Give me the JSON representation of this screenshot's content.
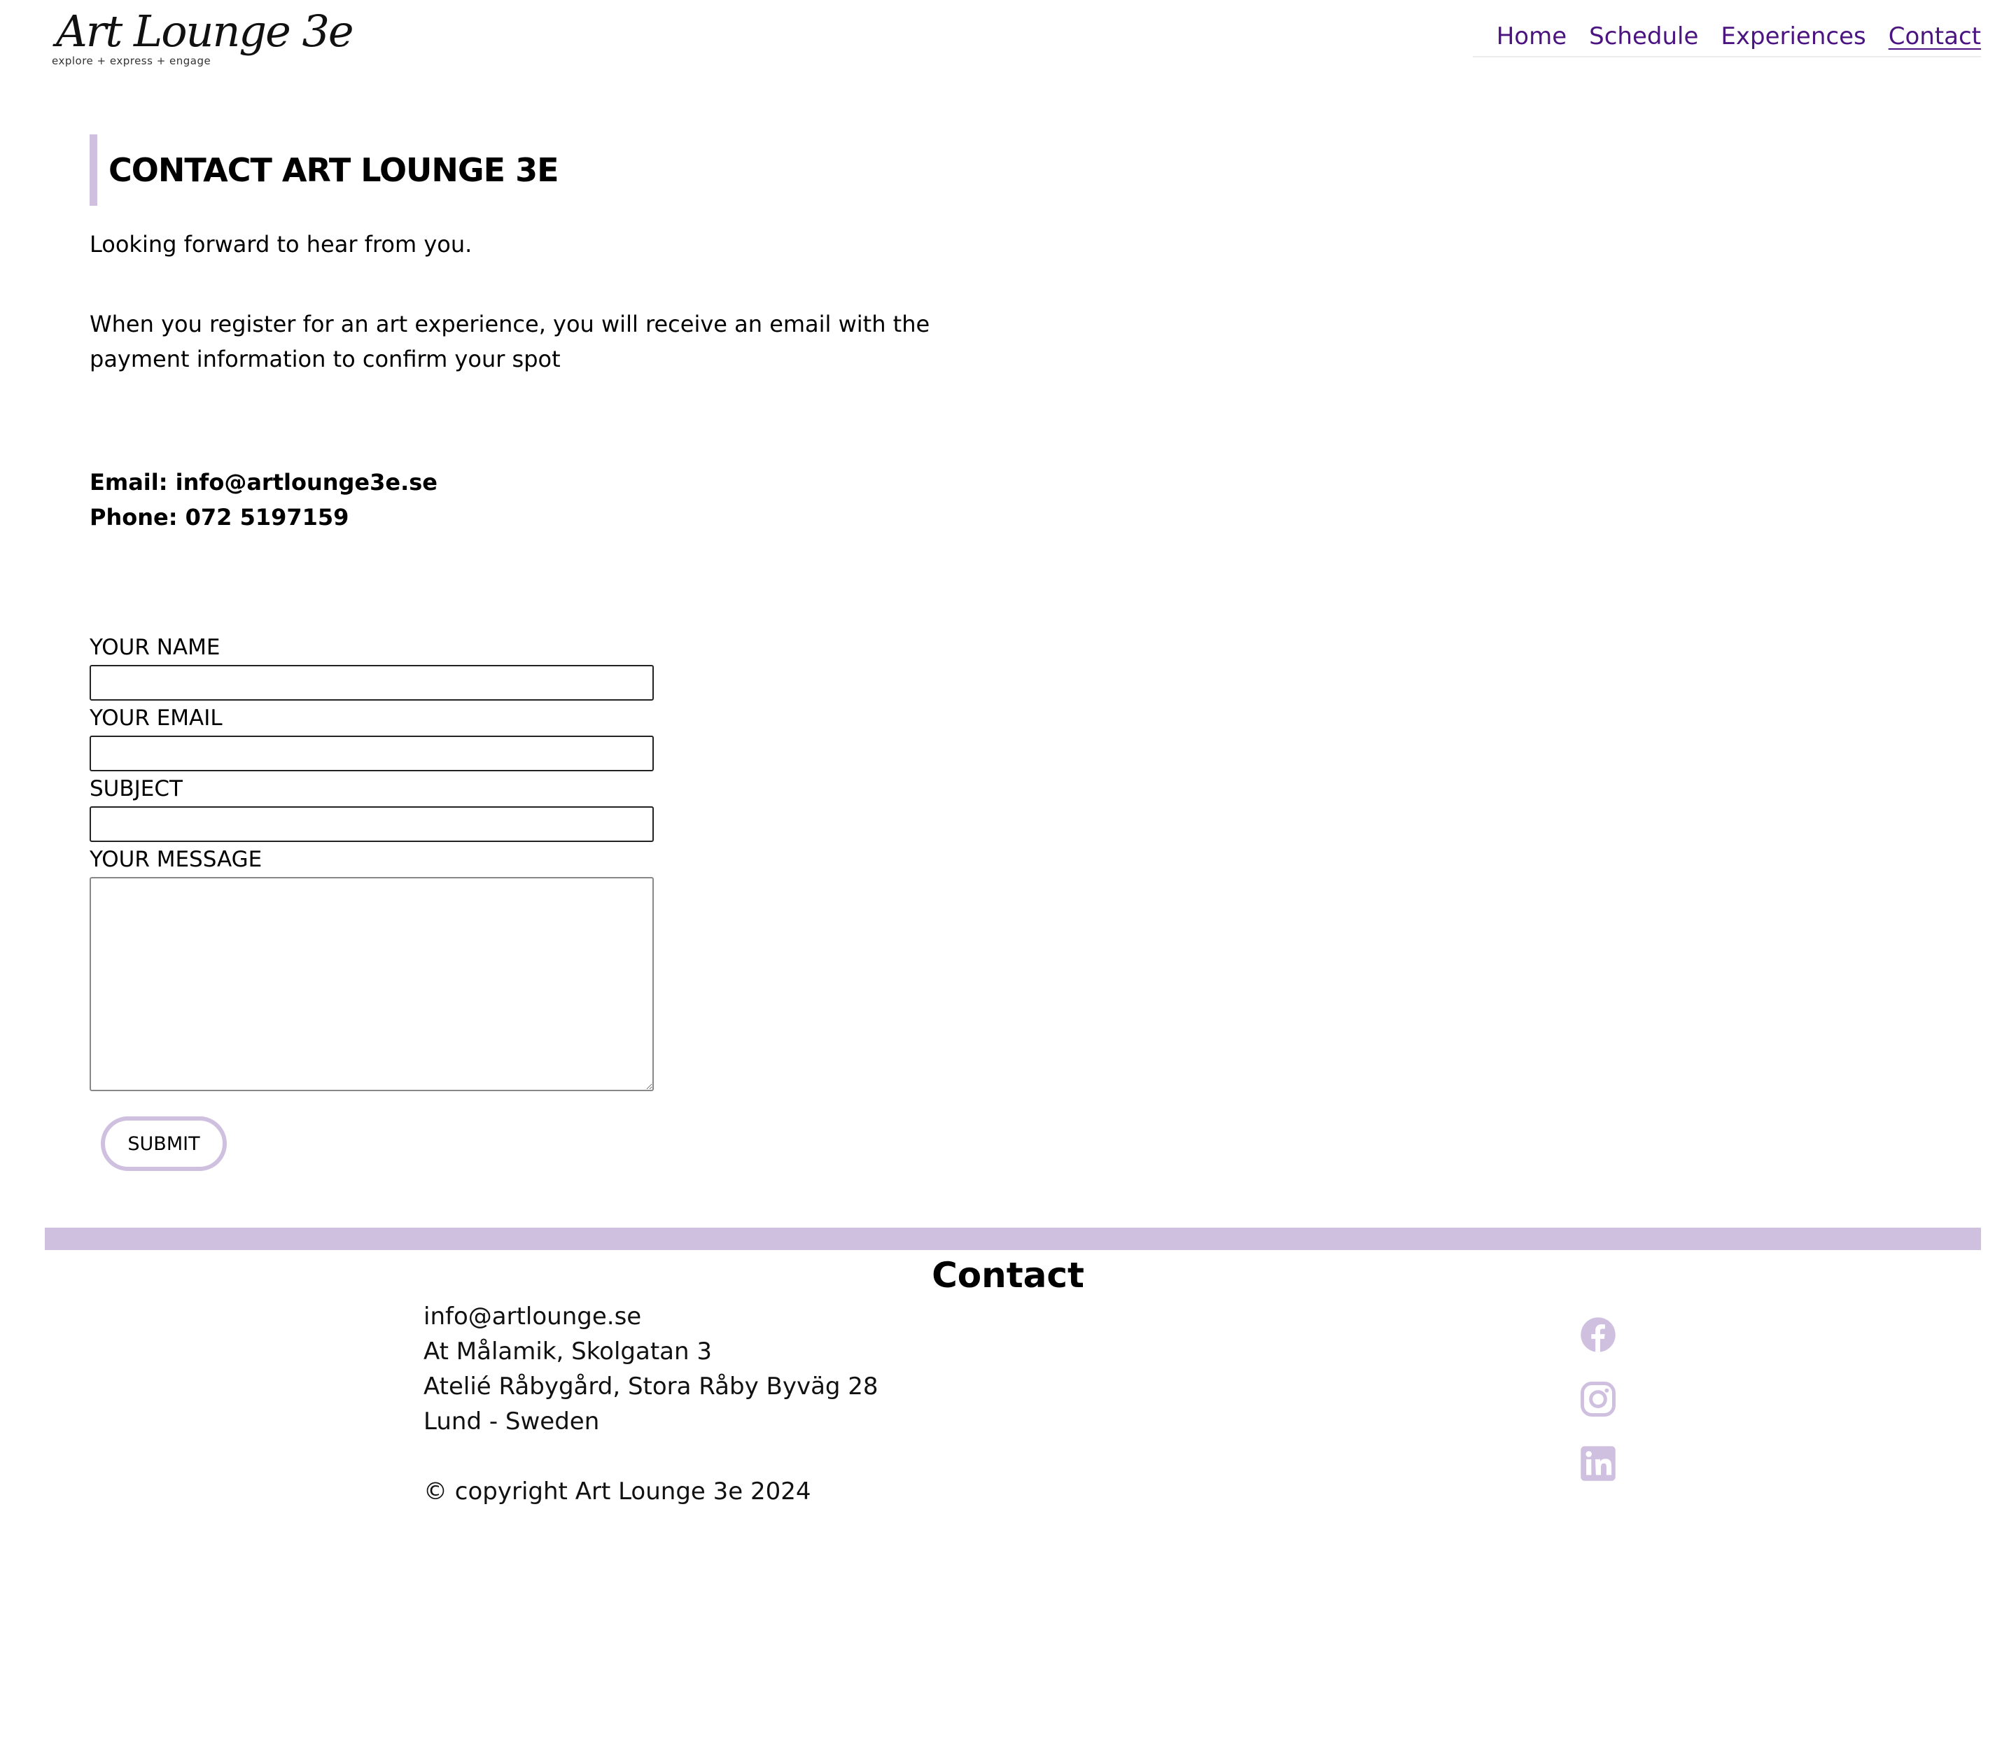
{
  "header": {
    "logo": {
      "script_text": "Art Lounge 3e",
      "tagline": "explore + express + engage"
    },
    "nav": [
      {
        "label": "Home",
        "active": false
      },
      {
        "label": "Schedule",
        "active": false
      },
      {
        "label": "Experiences",
        "active": false
      },
      {
        "label": "Contact",
        "active": true
      }
    ]
  },
  "main": {
    "title": "CONTACT ART LOUNGE 3E",
    "intro": "Looking forward to hear from you.",
    "payment_note": "When you register for an art experience, you will receive an email with the payment information to confirm your spot",
    "email_line": "Email: info@artlounge3e.se",
    "phone_line": "Phone: 072 5197159"
  },
  "form": {
    "name_label": "YOUR NAME",
    "name_value": "",
    "email_label": "YOUR EMAIL",
    "email_value": "",
    "subject_label": "SUBJECT",
    "subject_value": "",
    "message_label": "YOUR MESSAGE",
    "message_value": "",
    "submit_label": "SUBMIT"
  },
  "footer": {
    "title": "Contact",
    "lines": [
      "info@artlounge.se",
      "At Målamik, Skolgatan 3",
      "Atelié Råbygård, Stora Råby Byväg 28",
      "Lund - Sweden"
    ],
    "copyright": "© copyright Art Lounge 3e 2024",
    "social": [
      "facebook-icon",
      "instagram-icon",
      "linkedin-icon"
    ]
  },
  "colors": {
    "accent_lavender": "#cfc0e0",
    "nav_purple": "#4b1480",
    "text": "#000000"
  }
}
